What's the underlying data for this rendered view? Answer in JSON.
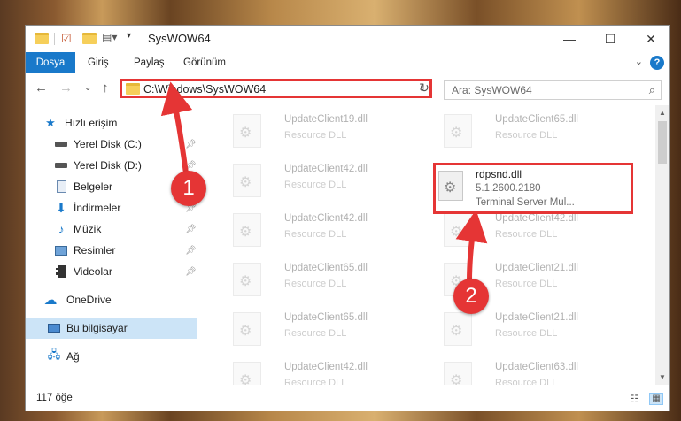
{
  "window": {
    "title": "SysWOW64",
    "minimize": "—",
    "maximize": "☐",
    "close": "✕"
  },
  "ribbon": {
    "file": "Dosya",
    "home": "Giriş",
    "share": "Paylaş",
    "view": "Görünüm",
    "help": "?"
  },
  "address": {
    "path": "C:\\Windows\\SysWOW64",
    "search_placeholder": "Ara: SysWOW64"
  },
  "sidebar": {
    "items": [
      {
        "label": "Hızlı erişim",
        "icon": "star-icon"
      },
      {
        "label": "Yerel Disk (C:)",
        "icon": "drive-icon"
      },
      {
        "label": "Yerel Disk (D:)",
        "icon": "drive-icon"
      },
      {
        "label": "Belgeler",
        "icon": "documents-icon"
      },
      {
        "label": "İndirmeler",
        "icon": "download-icon"
      },
      {
        "label": "Müzik",
        "icon": "music-icon"
      },
      {
        "label": "Resimler",
        "icon": "pictures-icon"
      },
      {
        "label": "Videolar",
        "icon": "video-icon"
      },
      {
        "label": "OneDrive",
        "icon": "cloud-icon"
      },
      {
        "label": "Bu bilgisayar",
        "icon": "computer-icon"
      },
      {
        "label": "Ağ",
        "icon": "network-icon"
      }
    ]
  },
  "files": {
    "col1": [
      {
        "name": "UpdateClient19.dll",
        "sub": "Resource DLL"
      },
      {
        "name": "UpdateClient42.dll",
        "sub": "Resource DLL"
      },
      {
        "name": "UpdateClient42.dll",
        "sub": "Resource DLL"
      },
      {
        "name": "UpdateClient65.dll",
        "sub": "Resource DLL"
      },
      {
        "name": "UpdateClient65.dll",
        "sub": "Resource DLL"
      },
      {
        "name": "UpdateClient42.dll",
        "sub": "Resource DLL"
      }
    ],
    "col2": [
      {
        "name": "UpdateClient65.dll",
        "sub": "Resource DLL"
      },
      {
        "name": "UpdateClient42.dll",
        "sub": "Resource DLL"
      },
      {
        "name": "UpdateClient21.dll",
        "sub": "Resource DLL"
      },
      {
        "name": "UpdateClient21.dll",
        "sub": "Resource DLL"
      },
      {
        "name": "UpdateClient63.dll",
        "sub": "Resource DLL"
      }
    ],
    "highlighted": {
      "name": "rdpsnd.dll",
      "version": "5.1.2600.2180",
      "description": "Terminal Server Mul..."
    }
  },
  "status": {
    "count": "117 öğe"
  },
  "callouts": {
    "one": "1",
    "two": "2"
  },
  "colors": {
    "accent": "#1979ca",
    "highlight": "#e53535"
  }
}
